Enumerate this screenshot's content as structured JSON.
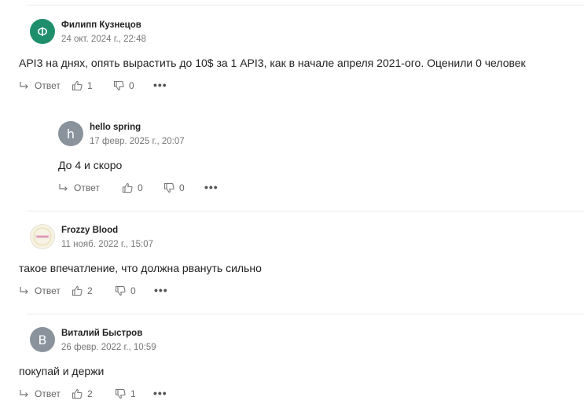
{
  "actions": {
    "reply_label": "Ответ",
    "more_label": "•••"
  },
  "comments": [
    {
      "author": "Филипп Кузнецов",
      "date": "24 окт. 2024 г., 22:48",
      "avatar_letter": "Ф",
      "avatar_color": "#1e8f6a",
      "text": "API3 на днях, опять вырастить до 10$ за 1 API3, как в начале апреля 2021-ого. Оценили 0 человек",
      "likes": "1",
      "dislikes": "0"
    },
    {
      "author": "hello spring",
      "date": "17 февр. 2025 г., 20:07",
      "avatar_letter": "h",
      "avatar_color": "#8a939c",
      "text": "До 4 и скоро",
      "likes": "0",
      "dislikes": "0"
    },
    {
      "author": "Frozzy Blood",
      "date": "11 нояб. 2022 г., 15:07",
      "avatar_letter": "",
      "text": "такое впечатление, что должна рвануть сильно",
      "likes": "2",
      "dislikes": "0"
    },
    {
      "author": "Виталий Быстров",
      "date": "26 февр. 2022 г., 10:59",
      "avatar_letter": "В",
      "avatar_color": "#8a939c",
      "text": "покупай и держи",
      "likes": "2",
      "dislikes": "1"
    }
  ]
}
